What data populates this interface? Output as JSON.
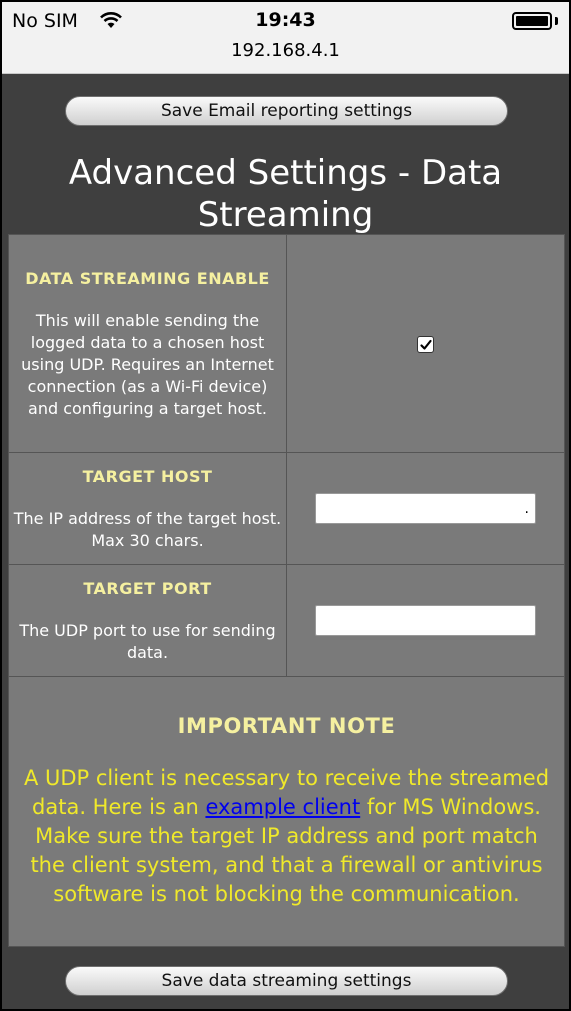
{
  "status_bar": {
    "carrier": "No SIM",
    "time": "19:43",
    "url": "192.168.4.1"
  },
  "buttons": {
    "save_email": "Save Email reporting settings",
    "save_streaming": "Save data streaming settings"
  },
  "page_title": "Advanced Settings - Data Streaming",
  "rows": [
    {
      "label": "DATA STREAMING ENABLE",
      "description": "This will enable sending the logged data to a chosen host using UDP. Requires an Internet connection (as a Wi-Fi device) and configuring a target host.",
      "checked": true
    },
    {
      "label": "TARGET HOST",
      "description": "The IP address of the target host. Max 30 chars.",
      "value": "."
    },
    {
      "label": "TARGET PORT",
      "description": "The UDP port to use for sending data.",
      "value": ""
    }
  ],
  "note": {
    "title": "IMPORTANT NOTE",
    "text_before": "A UDP client is necessary to receive the streamed data. Here is an ",
    "link": "example client",
    "text_after": " for MS Windows. Make sure the target IP address and port match the client system, and that a firewall or antivirus software is not blocking the communication."
  },
  "colors": {
    "background": "#3f3f3f",
    "table": "#7a7a7a",
    "label_yellow": "#f5f0a0",
    "note_yellow": "#f0e92a",
    "link": "#0000ee"
  }
}
